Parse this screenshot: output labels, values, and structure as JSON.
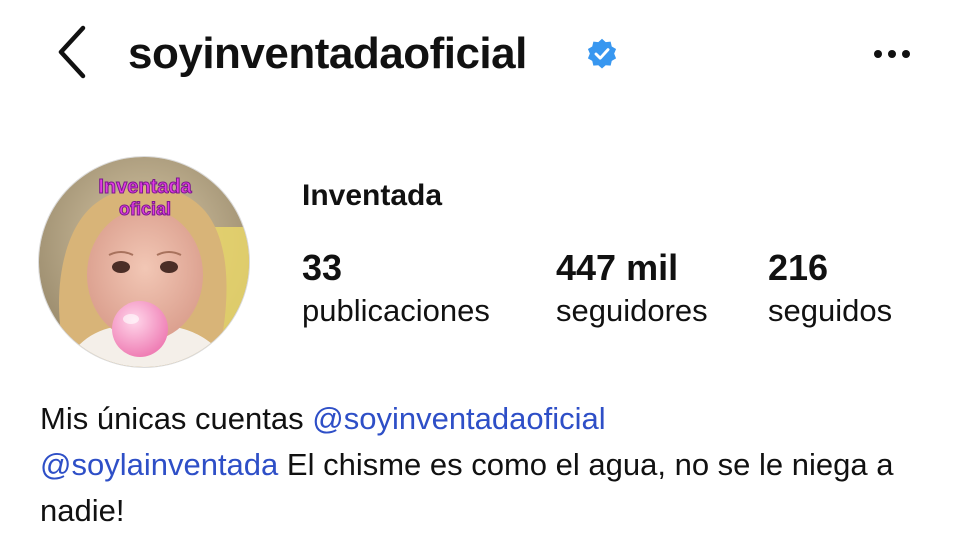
{
  "header": {
    "username": "soyinventadaoficial",
    "back_icon": "chevron-left-icon",
    "verified_icon": "verified-badge-icon",
    "more_icon": "more-horizontal-icon"
  },
  "avatar": {
    "overlay_text_line1": "Inventada",
    "overlay_text_line2": "oficial"
  },
  "profile": {
    "display_name": "Inventada",
    "stats": {
      "posts": {
        "value": "33",
        "label": "publicaciones"
      },
      "followers": {
        "value": "447 mil",
        "label": "seguidores"
      },
      "following": {
        "value": "216",
        "label": "seguidos"
      }
    }
  },
  "bio": {
    "line1_text": "Mis únicas cuentas ",
    "mention1": "@soyinventadaoficial",
    "mention2": "@soylainventada",
    "line2_text": " El chisme es como el agua, no se le niega a nadie!"
  },
  "colors": {
    "verified": "#3897f0",
    "mention": "#2e4fc7",
    "text": "#111111"
  }
}
